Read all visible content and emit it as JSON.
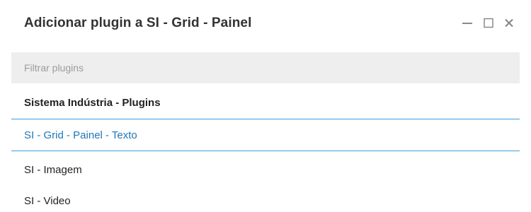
{
  "dialog": {
    "title": "Adicionar plugin a SI - Grid - Painel",
    "controls": {
      "minimize_icon": "minimize-icon",
      "maximize_icon": "maximize-icon",
      "close_icon": "close-icon"
    }
  },
  "filter": {
    "placeholder": "Filtrar plugins",
    "value": ""
  },
  "plugin_list": {
    "group_label": "Sistema Indústria - Plugins",
    "items": [
      {
        "label": "SI - Grid - Painel - Texto",
        "selected": true
      },
      {
        "label": "SI - Imagem",
        "selected": false
      },
      {
        "label": "SI - Video",
        "selected": false
      }
    ]
  },
  "colors": {
    "accent": "#3aa0dc",
    "selected_text": "#2277b5",
    "filter_background": "#eeeeee",
    "placeholder_text": "#9c9c9c"
  }
}
